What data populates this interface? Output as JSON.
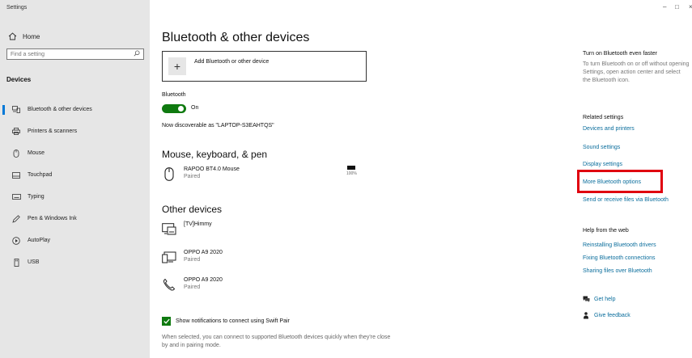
{
  "window": {
    "title": "Settings",
    "minimize": "–",
    "maximize": "□",
    "close": "×"
  },
  "sidebar": {
    "home_label": "Home",
    "search_placeholder": "Find a setting",
    "section_title": "Devices",
    "items": [
      {
        "label": "Bluetooth & other devices",
        "icon": "bluetooth-devices-icon",
        "active": true
      },
      {
        "label": "Printers & scanners",
        "icon": "printer-icon"
      },
      {
        "label": "Mouse",
        "icon": "mouse-icon"
      },
      {
        "label": "Touchpad",
        "icon": "touchpad-icon"
      },
      {
        "label": "Typing",
        "icon": "keyboard-icon"
      },
      {
        "label": "Pen & Windows Ink",
        "icon": "pen-icon"
      },
      {
        "label": "AutoPlay",
        "icon": "autoplay-icon"
      },
      {
        "label": "USB",
        "icon": "usb-icon"
      }
    ]
  },
  "main": {
    "title": "Bluetooth & other devices",
    "add_device_label": "Add Bluetooth or other device",
    "bluetooth_label": "Bluetooth",
    "bluetooth_state": "On",
    "discoverable_text": "Now discoverable as \"LAPTOP-S3EAHTQS\"",
    "mouse_section_title": "Mouse, keyboard, & pen",
    "mouse_device": {
      "name": "RAPOO BT4.0 Mouse",
      "status": "Paired",
      "battery": "100%"
    },
    "other_section_title": "Other devices",
    "other_devices": [
      {
        "name": "[TV]Himmy",
        "status": "",
        "icon": "tv-icon"
      },
      {
        "name": "OPPO A9 2020",
        "status": "Paired",
        "icon": "phone-device-icon"
      },
      {
        "name": "OPPO A9 2020",
        "status": "Paired",
        "icon": "phone-icon"
      }
    ],
    "swift_pair_label": "Show notifications to connect using Swift Pair",
    "swift_pair_desc": "When selected, you can connect to supported Bluetooth devices quickly when they're close by and in pairing mode."
  },
  "right": {
    "tip_title": "Turn on Bluetooth even faster",
    "tip_text": "To turn Bluetooth on or off without opening Settings, open action center and select the Bluetooth icon.",
    "related_title": "Related settings",
    "related_links": [
      "Devices and printers",
      "Sound settings",
      "Display settings",
      "More Bluetooth options",
      "Send or receive files via Bluetooth"
    ],
    "help_title": "Help from the web",
    "help_links": [
      "Reinstalling Bluetooth drivers",
      "Fixing Bluetooth connections",
      "Sharing files over Bluetooth"
    ],
    "get_help": "Get help",
    "give_feedback": "Give feedback"
  },
  "colors": {
    "accent": "#0078d7",
    "toggle_on": "#0f7a10",
    "link": "#0a6d9c",
    "highlight": "#e0000f",
    "sidebar_bg": "#e6e6e6"
  }
}
